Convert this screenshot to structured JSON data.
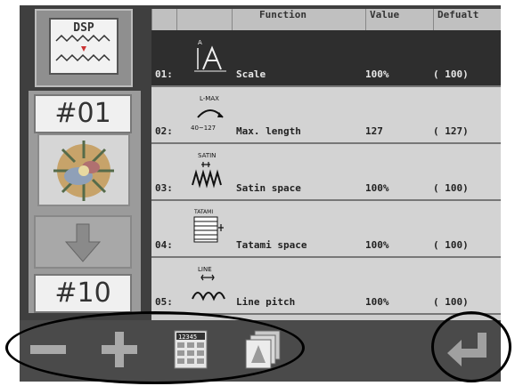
{
  "left_panel": {
    "dsp_label": "DSP",
    "design_start": "#01",
    "design_end": "#10"
  },
  "table": {
    "headers": [
      "Function",
      "Value",
      "Defualt"
    ],
    "rows": [
      {
        "num": "01:",
        "icon_text": "A",
        "function": "Scale",
        "value": "100%",
        "default": "( 100)",
        "selected": true
      },
      {
        "num": "02:",
        "icon_text": "L-MAX",
        "icon_sub": "40~127",
        "function": "Max. length",
        "value": "127",
        "default": "( 127)",
        "selected": false
      },
      {
        "num": "03:",
        "icon_text": "SATIN",
        "function": "Satin space",
        "value": "100%",
        "default": "( 100)",
        "selected": false
      },
      {
        "num": "04:",
        "icon_text": "TATAMI",
        "function": "Tatami space",
        "value": "100%",
        "default": "( 100)",
        "selected": false
      },
      {
        "num": "05:",
        "icon_text": "LINE",
        "function": "Line pitch",
        "value": "100%",
        "default": "( 100)",
        "selected": false
      }
    ]
  },
  "bottom_bar": {
    "calc_label": "12345",
    "icons": [
      "minus-icon",
      "plus-icon",
      "keypad-icon",
      "copy-layers-icon",
      "enter-return-icon"
    ]
  },
  "colors": {
    "screen_bg": "#3f3f3f",
    "row_bg": "#d3d3d3",
    "selected_row": "#2e2e2e",
    "icon_gray": "#a0a0a0"
  }
}
